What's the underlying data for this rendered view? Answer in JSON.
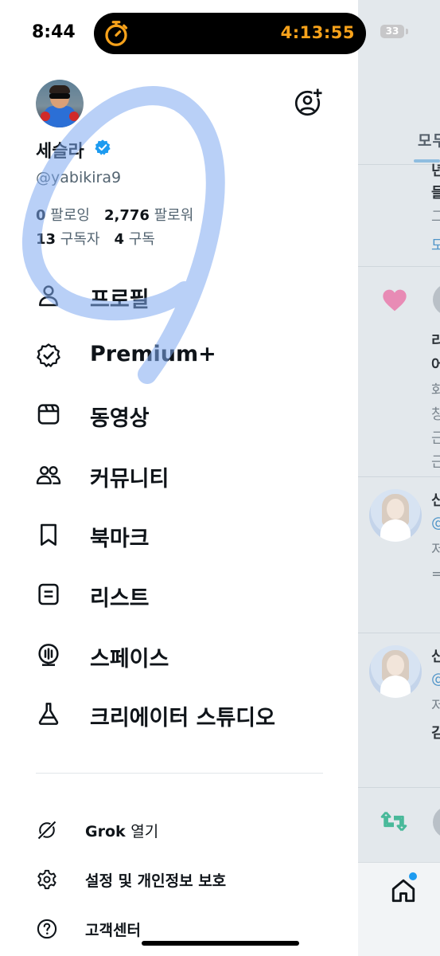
{
  "status_bar": {
    "time": "8:44",
    "timer": "4:13:55",
    "battery_level": "33"
  },
  "profile": {
    "display_name": "세슬라",
    "handle": "@yabikira9",
    "verified": true,
    "stats": {
      "following_count": "0",
      "following_label": "팔로잉",
      "followers_count": "2,776",
      "followers_label": "팔로워",
      "subscribers_count": "13",
      "subscribers_label": "구독자",
      "subscriptions_count": "4",
      "subscriptions_label": "구독"
    }
  },
  "menu": [
    {
      "label": "프로필",
      "icon": "person-icon"
    },
    {
      "label": "Premium+",
      "icon": "premium-badge-icon"
    },
    {
      "label": "동영상",
      "icon": "video-icon"
    },
    {
      "label": "커뮤니티",
      "icon": "communities-icon"
    },
    {
      "label": "북마크",
      "icon": "bookmark-icon"
    },
    {
      "label": "리스트",
      "icon": "list-icon"
    },
    {
      "label": "스페이스",
      "icon": "spaces-icon"
    },
    {
      "label": "크리에이터 스튜디오",
      "icon": "flask-icon"
    }
  ],
  "secondary_menu": {
    "grok": {
      "bold": "Grok",
      "rest": "열기",
      "icon": "grok-icon"
    },
    "settings": {
      "label": "설정 및 개인정보 보호",
      "icon": "gear-icon"
    },
    "help": {
      "label": "고객센터",
      "icon": "help-icon"
    }
  },
  "background_timeline": {
    "tab_fragment": "모두",
    "fragments": [
      "년",
      "들",
      "그",
      "모",
      "리",
      "어",
      "화",
      "창",
      "근",
      "근",
      "신",
      "@",
      "저",
      "=",
      "신",
      "@",
      "저",
      "김"
    ]
  },
  "colors": {
    "accent": "#1d9bf0",
    "timer_orange": "#f7a21b",
    "highlighter": "#7faaf0",
    "like_pink": "#e88bb5",
    "retweet_green": "#49b99a"
  }
}
